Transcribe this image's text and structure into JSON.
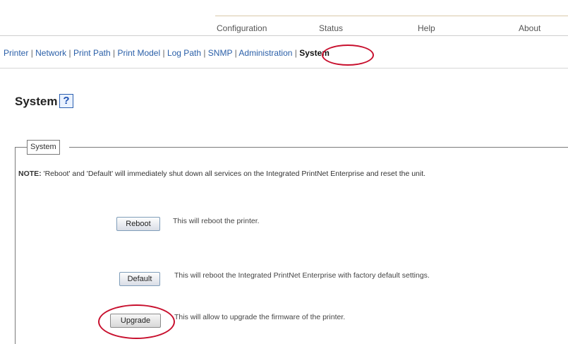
{
  "top_nav": [
    {
      "label": "Configuration"
    },
    {
      "label": "Status"
    },
    {
      "label": "Help"
    },
    {
      "label": "About"
    }
  ],
  "sub_nav": [
    {
      "label": "Printer"
    },
    {
      "label": "Network"
    },
    {
      "label": "Print Path"
    },
    {
      "label": "Print Model"
    },
    {
      "label": "Log Path"
    },
    {
      "label": "SNMP"
    },
    {
      "label": "Administration"
    },
    {
      "label": "System"
    }
  ],
  "page": {
    "title": "System",
    "help_glyph": "?"
  },
  "fieldset": {
    "legend": "System",
    "note_label": "NOTE:",
    "note_text": " 'Reboot' and 'Default' will immediately shut down all services on the Integrated PrintNet Enterprise and reset the unit."
  },
  "actions": [
    {
      "button": "Reboot",
      "description": "This will reboot the printer."
    },
    {
      "button": "Default",
      "description": "This will reboot the Integrated PrintNet Enterprise with factory default settings."
    },
    {
      "button": "Upgrade",
      "description": "This will allow to upgrade the firmware of the printer."
    }
  ],
  "colors": {
    "highlight_circle": "#c8102e",
    "link": "#2a5fa8"
  },
  "icons": {
    "help": "help-icon"
  }
}
